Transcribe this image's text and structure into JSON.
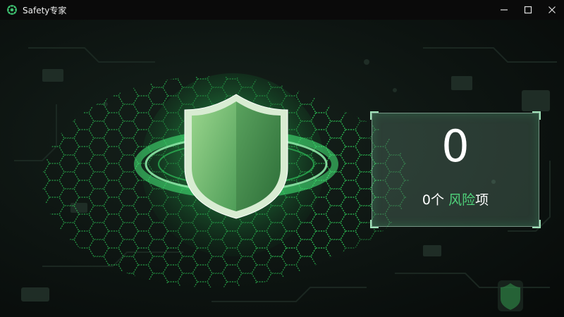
{
  "window": {
    "title": "Safety专家",
    "controls": {
      "minimize": "minimize-icon",
      "maximize": "maximize-icon",
      "close": "close-icon"
    }
  },
  "status": {
    "risk_count": "0",
    "label_number": "0",
    "label_unit": "个",
    "label_highlight": "风险",
    "label_suffix": "项"
  },
  "colors": {
    "accent": "#4fd27a",
    "shield_dark": "#3e8a4a",
    "shield_light": "#7fcf7f",
    "glow": "#2fbf5a",
    "titlebar": "#0a0a0a"
  },
  "icons": {
    "app": "shield-chip-icon",
    "main": "shield-icon",
    "decor": "small-shield-icon"
  }
}
